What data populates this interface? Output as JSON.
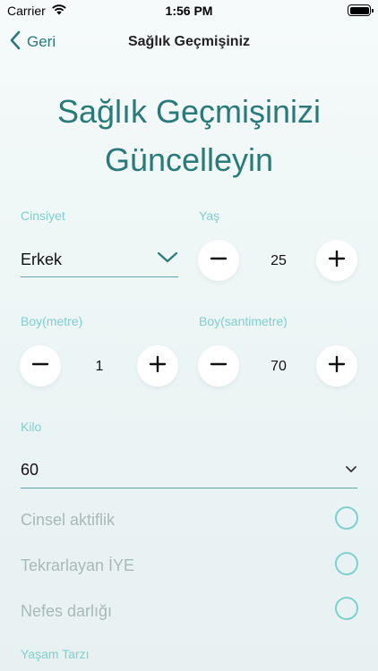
{
  "status_bar": {
    "carrier": "Carrier",
    "time": "1:56 PM"
  },
  "nav": {
    "back_label": "Geri",
    "title": "Sağlık Geçmişiniz"
  },
  "page": {
    "title_line1": "Sağlık Geçmişinizi",
    "title_line2": "Güncelleyin"
  },
  "gender": {
    "label": "Cinsiyet",
    "value": "Erkek"
  },
  "age": {
    "label": "Yaş",
    "value": "25"
  },
  "height_m": {
    "label": "Boy(metre)",
    "value": "1"
  },
  "height_cm": {
    "label": "Boy(santimetre)",
    "value": "70"
  },
  "weight": {
    "label": "Kilo",
    "value": "60"
  },
  "conditions": [
    {
      "label": "Cinsel aktiflik",
      "checked": false
    },
    {
      "label": "Tekrarlayan İYE",
      "checked": false
    },
    {
      "label": "Nefes darlığı",
      "checked": false
    }
  ],
  "lifestyle": {
    "label": "Yaşam Tarzı"
  },
  "colors": {
    "accent": "#2a7a79",
    "label": "#7fcfd0",
    "line": "#5fa7a8"
  }
}
